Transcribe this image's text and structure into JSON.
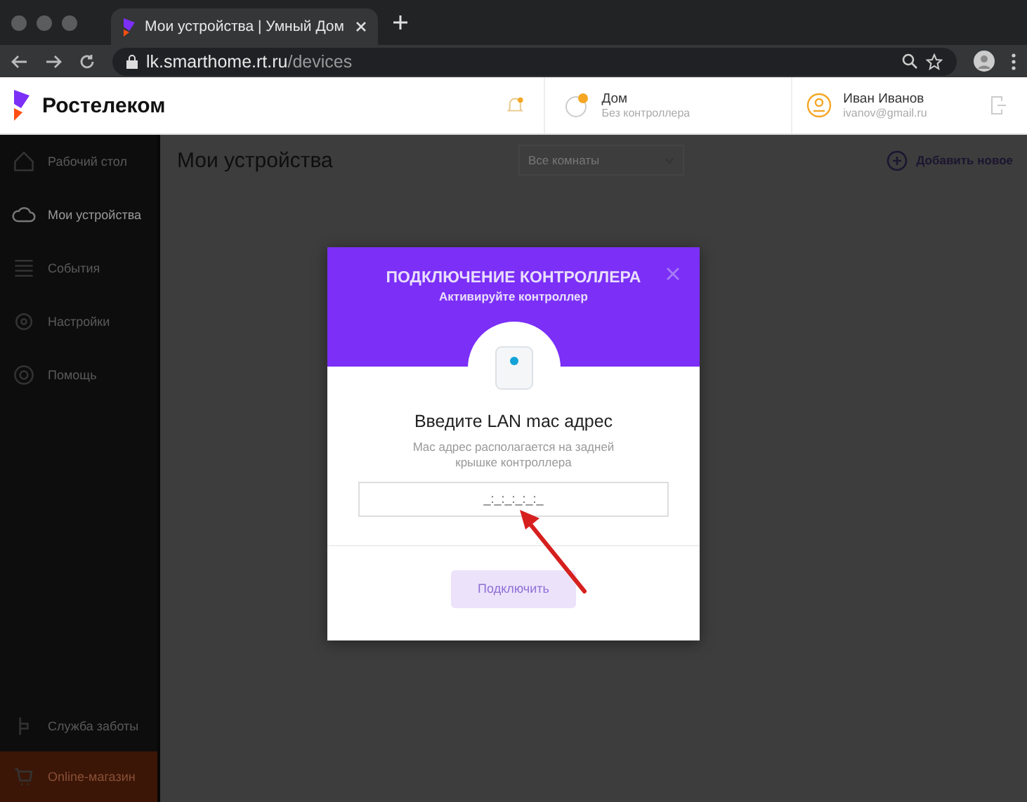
{
  "browser": {
    "tab_title": "Мои устройства | Умный Дом",
    "url_host": "lk.smarthome.rt.ru",
    "url_path": "/devices"
  },
  "header": {
    "logo": "Ростелеком",
    "home": {
      "name": "Дом",
      "status": "Без контроллера"
    },
    "user": {
      "name": "Иван Иванов",
      "email": "ivanov@gmail.ru"
    }
  },
  "sidebar": {
    "items": [
      {
        "label": "Рабочий стол",
        "selected": false
      },
      {
        "label": "Мои устройства",
        "selected": true
      },
      {
        "label": "События",
        "selected": false
      },
      {
        "label": "Настройки",
        "selected": false
      },
      {
        "label": "Помощь",
        "selected": false
      }
    ],
    "bottom": [
      {
        "label": "Служба заботы",
        "kind": "plain"
      },
      {
        "label": "Online-магазин",
        "kind": "shop"
      }
    ]
  },
  "page": {
    "title": "Мои устройства",
    "room_select": "Все комнаты",
    "add_button": "Добавить новое"
  },
  "modal": {
    "title": "ПОДКЛЮЧЕНИЕ КОНТРОЛЛЕРА",
    "subtitle": "Активируйте контроллер",
    "heading": "Введите LAN mac адрес",
    "hint": "Mac адрес располагается на задней крышке контроллера",
    "placeholder": "_:_:_:_:_:_",
    "button": {
      "label": "Подключить",
      "disabled": true
    }
  }
}
